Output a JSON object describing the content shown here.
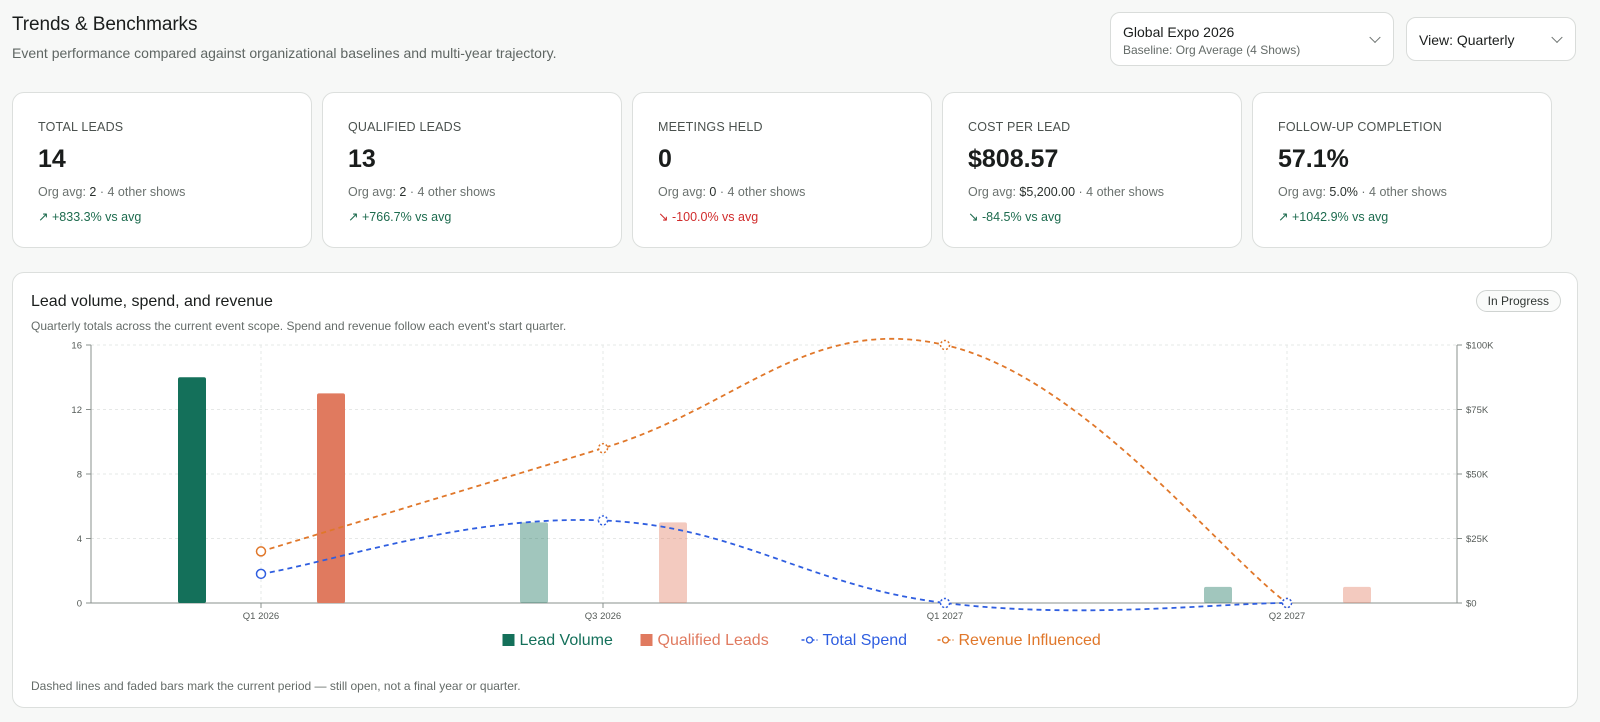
{
  "header": {
    "title": "Trends & Benchmarks",
    "subtitle": "Event performance compared against organizational baselines and multi-year trajectory."
  },
  "event_select": {
    "value": "Global Expo 2026",
    "baseline": "Baseline: Org Average (4 Shows)"
  },
  "view_select": {
    "value": "View: Quarterly"
  },
  "kpis": [
    {
      "label": "TOTAL LEADS",
      "value": "14",
      "avg_prefix": "Org avg:",
      "avg_value": "2",
      "avg_suffix": "· 4 other shows",
      "delta": "+833.3% vs avg",
      "direction": "up"
    },
    {
      "label": "QUALIFIED LEADS",
      "value": "13",
      "avg_prefix": "Org avg:",
      "avg_value": "2",
      "avg_suffix": "· 4 other shows",
      "delta": "+766.7% vs avg",
      "direction": "up"
    },
    {
      "label": "MEETINGS HELD",
      "value": "0",
      "avg_prefix": "Org avg:",
      "avg_value": "0",
      "avg_suffix": "· 4 other shows",
      "delta": "-100.0% vs avg",
      "direction": "down"
    },
    {
      "label": "COST PER LEAD",
      "value": "$808.57",
      "avg_prefix": "Org avg:",
      "avg_value": "$5,200.00",
      "avg_suffix": "· 4 other shows",
      "delta": "-84.5% vs avg",
      "direction": "down-good"
    },
    {
      "label": "FOLLOW-UP COMPLETION",
      "value": "57.1%",
      "avg_prefix": "Org avg:",
      "avg_value": "5.0%",
      "avg_suffix": "· 4 other shows",
      "delta": "+1042.9% vs avg",
      "direction": "up"
    }
  ],
  "chart_card": {
    "title": "Lead volume, spend, and revenue",
    "subtitle": "Quarterly totals across the current event scope. Spend and revenue follow each event's start quarter.",
    "badge": "In Progress",
    "footnote": "Dashed lines and faded bars mark the current period — still open, not a final year or quarter."
  },
  "colors": {
    "lead": "#14705a",
    "qualified": "#e07a5f",
    "spend": "#2f5ee0",
    "revenue": "#e0772a"
  },
  "chart_data": {
    "type": "bar",
    "categories": [
      "Q1 2026",
      "Q3 2026",
      "Q1 2027",
      "Q2 2027"
    ],
    "y_left": {
      "ylim": [
        0,
        16
      ],
      "ticks": [
        "0",
        "4",
        "8",
        "12",
        "16"
      ]
    },
    "y_right": {
      "ylim": [
        0,
        100000
      ],
      "ticks": [
        "$0",
        "$25K",
        "$50K",
        "$75K",
        "$100K"
      ]
    },
    "grid": true,
    "legend_position": "bottom",
    "series": [
      {
        "name": "Lead Volume",
        "type": "bar",
        "axis": "left",
        "values": [
          14,
          5,
          0,
          1
        ],
        "faded": [
          false,
          true,
          true,
          true
        ]
      },
      {
        "name": "Qualified Leads",
        "type": "bar",
        "axis": "left",
        "values": [
          13,
          5,
          0,
          1
        ],
        "faded": [
          false,
          true,
          true,
          true
        ]
      },
      {
        "name": "Total Spend",
        "type": "line",
        "axis": "right",
        "dashed": true,
        "values": [
          11300,
          32000,
          0,
          0
        ]
      },
      {
        "name": "Revenue Influenced",
        "type": "line",
        "axis": "right",
        "dashed": true,
        "values": [
          20000,
          60000,
          100000,
          0
        ]
      }
    ]
  }
}
